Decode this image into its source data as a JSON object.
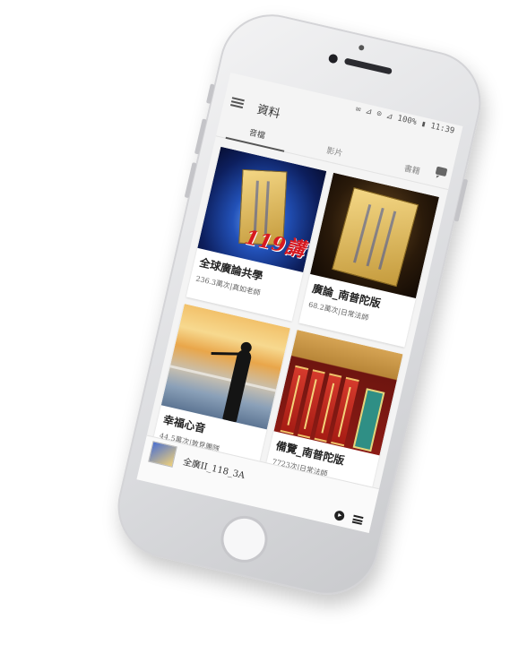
{
  "status_bar": {
    "text": "✉ ⊿ ⊙ ⊿ 100% ▮ 11:39"
  },
  "app_bar": {
    "title": "資料"
  },
  "tabs": [
    {
      "label": "音檔",
      "active": true
    },
    {
      "label": "影片",
      "active": false
    },
    {
      "label": "書籍",
      "active": false
    }
  ],
  "cards": [
    {
      "title": "全球廣論共學",
      "meta": "236.3萬次|真如老師",
      "thumb_badge": "119講"
    },
    {
      "title": "廣論_南普陀版",
      "meta": "68.2萬次|日常法師"
    },
    {
      "title": "幸福心音",
      "meta": "44.5萬次|敦見團隊"
    },
    {
      "title": "備覽_南普陀版",
      "meta": "7723次|日常法師"
    }
  ],
  "player": {
    "title": "全廣II_118_3A"
  },
  "icons": [
    "menu-icon",
    "chat-icon",
    "play-icon",
    "playlist-icon"
  ],
  "colors": {
    "accent_red": "#d71920",
    "background": "#f4f4f4"
  }
}
